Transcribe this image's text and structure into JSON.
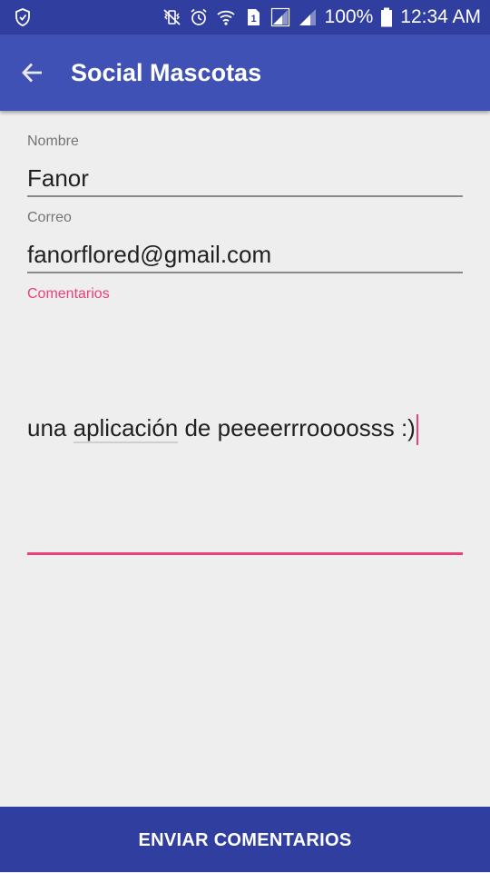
{
  "status_bar": {
    "battery": "100%",
    "time": "12:34 AM",
    "sim_slot": "1",
    "icons": [
      "shield-icon",
      "mute-vibrate-icon",
      "alarm-icon",
      "wifi-icon",
      "sim-icon",
      "signal-icon",
      "signal-icon-2",
      "battery-icon"
    ]
  },
  "toolbar": {
    "title": "Social Mascotas",
    "back_icon": "arrow-back-icon"
  },
  "form": {
    "name_label": "Nombre",
    "name_value": "Fanor",
    "email_label": "Correo",
    "email_value": "fanorflored@gmail.com",
    "comments_label": "Comentarios",
    "comments_before": "una ",
    "comments_misspelled": "aplicación",
    "comments_after": " de peeeerrroooosss :)"
  },
  "actions": {
    "send_label": "ENVIAR COMENTARIOS"
  },
  "colors": {
    "primary": "#3f51b5",
    "primary_dark": "#303f9f",
    "accent": "#ec407a",
    "background": "#eeeeee"
  }
}
